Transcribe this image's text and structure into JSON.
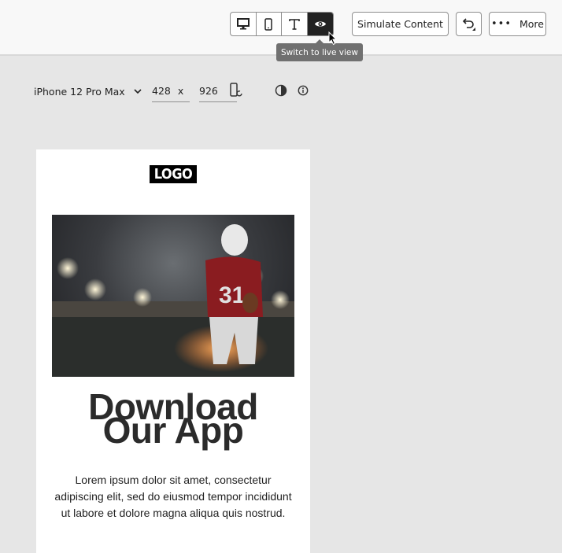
{
  "toolbar": {
    "view_modes": [
      {
        "name": "desktop-view",
        "icon": "desktop-icon"
      },
      {
        "name": "mobile-view",
        "icon": "mobile-icon"
      },
      {
        "name": "text-view",
        "icon": "text-icon"
      },
      {
        "name": "live-view",
        "icon": "eye-icon",
        "selected": true
      }
    ],
    "simulate_label": "Simulate Content",
    "more_label": "More",
    "tooltip": "Switch to live view"
  },
  "device": {
    "name": "iPhone 12 Pro Max",
    "width": "428",
    "separator": "x",
    "height": "926"
  },
  "email": {
    "logo": "LOGO",
    "headline_1": "Download",
    "headline_2": "Our App",
    "body": "Lorem ipsum dolor sit amet, consectetur adipiscing elit, sed do eiusmod tempor incididunt ut labore et dolore magna aliqua quis nostrud.",
    "jersey_number": "31"
  },
  "colors": {
    "selected": "#222222",
    "tooltip": "#707070",
    "canvas": "#e6e6e6"
  }
}
